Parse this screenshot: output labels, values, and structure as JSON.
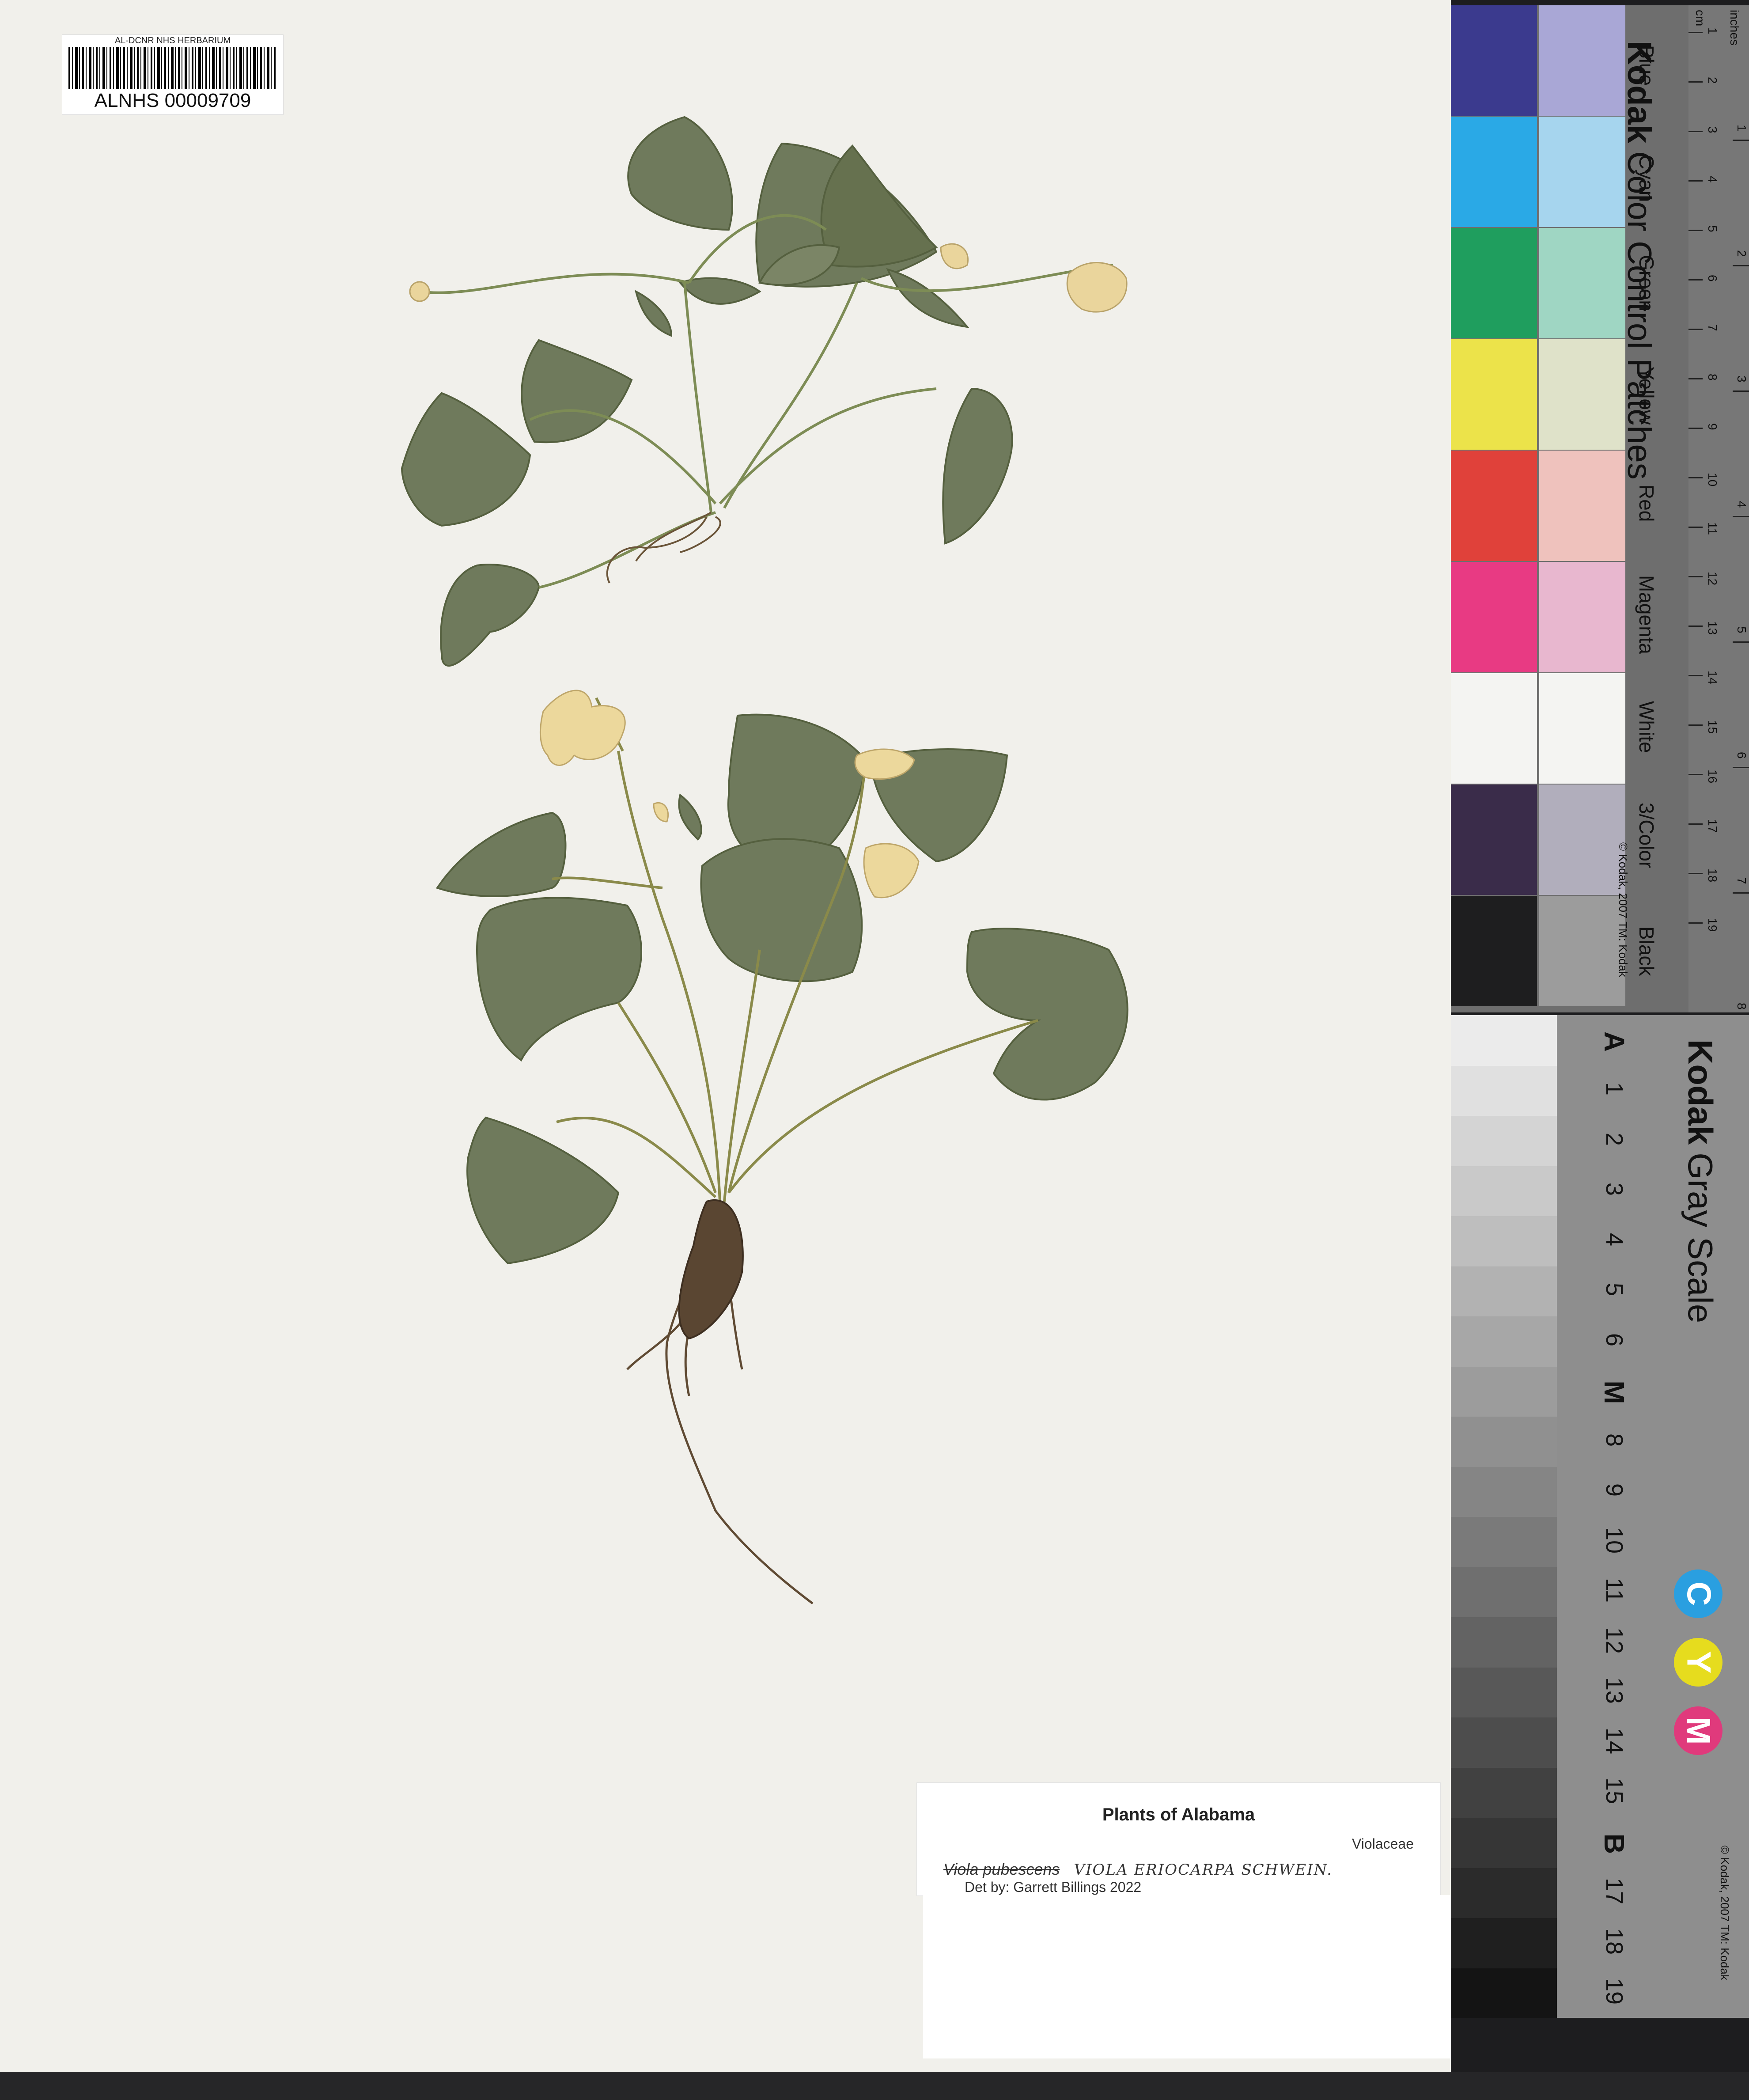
{
  "barcode": {
    "header": "AL-DCNR NHS HERBARIUM",
    "number": "ALNHS 00009709"
  },
  "label": {
    "title": "Plants of Alabama",
    "family": "Violaceae",
    "original_name": "Viola pubescens",
    "annotated_name": "VIOLA ERIOCARPA SCHWEIN.",
    "determination": "Det by: Garrett Billings 2022"
  },
  "color_card": {
    "brand": "Kodak",
    "title": "Color Control Patches",
    "copyright": "© Kodak, 2007 TM: Kodak",
    "unit_cm": "cm",
    "unit_inches": "inches",
    "patches": [
      {
        "name": "Blue",
        "dark": "#3b3a8e",
        "light": "#a9a7d6"
      },
      {
        "name": "Cyan",
        "dark": "#2aa9e6",
        "light": "#a6d5ee"
      },
      {
        "name": "Green",
        "dark": "#1f9e5e",
        "light": "#9fd6c3"
      },
      {
        "name": "Yellow",
        "dark": "#ece34a",
        "light": "#dfe2c9"
      },
      {
        "name": "Red",
        "dark": "#e0413a",
        "light": "#efc2bd"
      },
      {
        "name": "Magenta",
        "dark": "#e83a83",
        "light": "#e8b7cf"
      },
      {
        "name": "White",
        "dark": "#f4f4f2",
        "light": "#f4f4f2"
      },
      {
        "name": "3/Color",
        "dark": "#3a2c4a",
        "light": "#b1aebc"
      },
      {
        "name": "Black",
        "dark": "#1e1e1f",
        "light": "#9c9c9c"
      }
    ],
    "cm_ticks": [
      "1",
      "2",
      "3",
      "4",
      "5",
      "6",
      "7",
      "8",
      "9",
      "10",
      "11",
      "12",
      "13",
      "14",
      "15",
      "16",
      "17",
      "18",
      "19"
    ],
    "inch_ticks": [
      "1",
      "2",
      "3",
      "4",
      "5",
      "6",
      "7",
      "8"
    ]
  },
  "gray_scale": {
    "brand": "Kodak",
    "title": "Gray Scale",
    "copyright": "© Kodak, 2007 TM: Kodak",
    "steps": [
      "A",
      "1",
      "2",
      "3",
      "4",
      "5",
      "6",
      "M",
      "8",
      "9",
      "10",
      "11",
      "12",
      "13",
      "14",
      "15",
      "B",
      "17",
      "18",
      "19"
    ],
    "cym": [
      {
        "letter": "C",
        "color": "#2a9fe0"
      },
      {
        "letter": "Y",
        "color": "#e6dc1e"
      },
      {
        "letter": "M",
        "color": "#e03a7c"
      }
    ]
  }
}
